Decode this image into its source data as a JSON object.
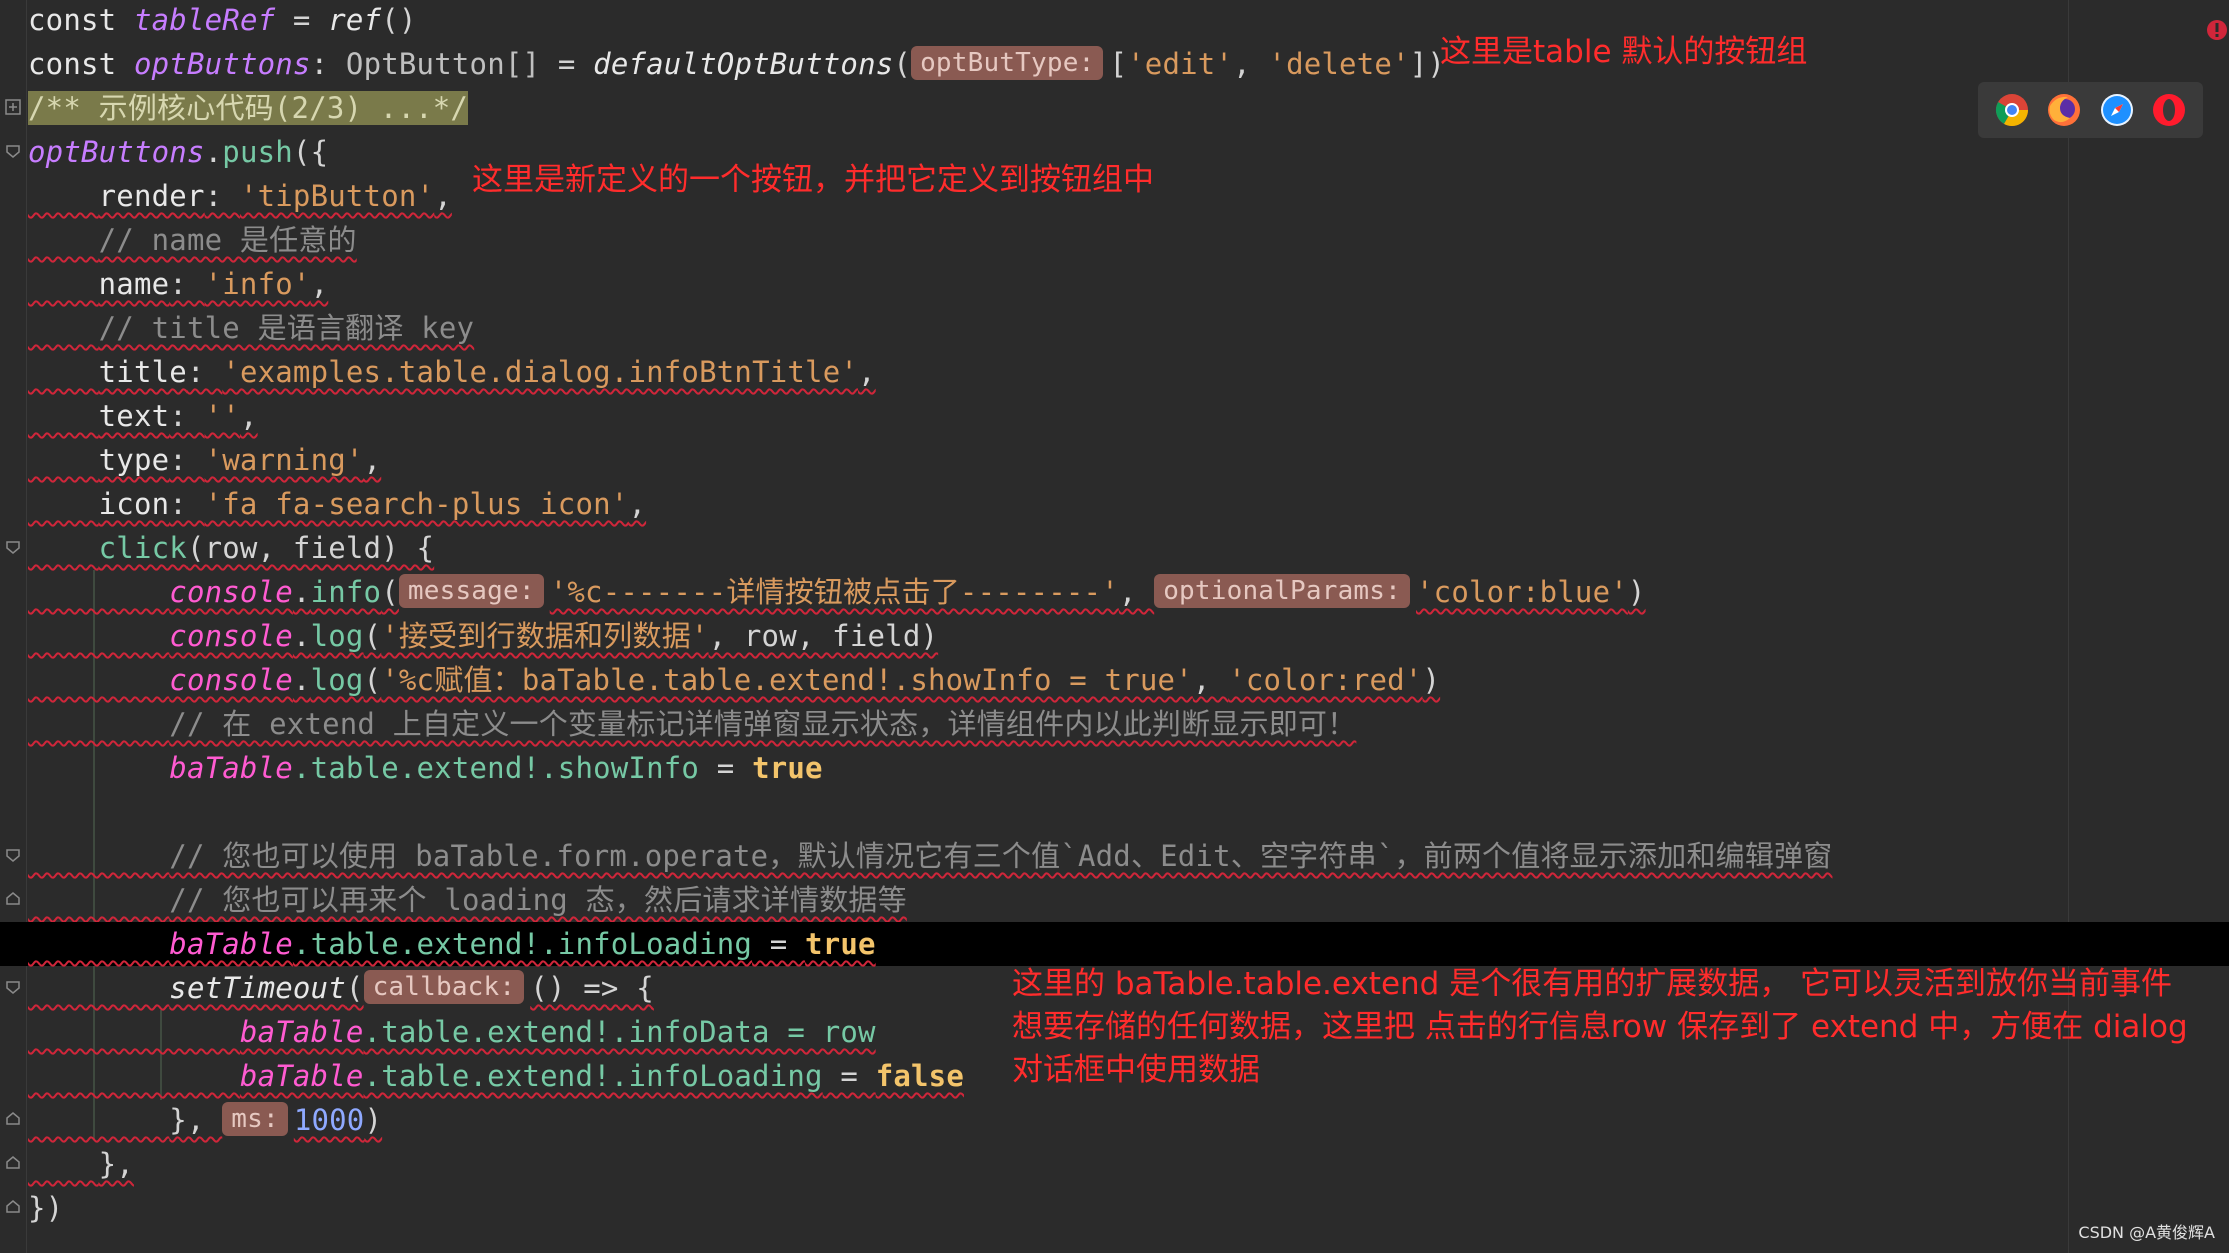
{
  "code": {
    "l1": {
      "kw": "const",
      "var": "tableRef",
      "op": " = ",
      "fn": "ref",
      "tail": "()"
    },
    "l2": {
      "kw": "const",
      "var": "optButtons",
      "colon": ": ",
      "type": "OptButton[]",
      "op": " = ",
      "fn": "defaultOptButtons",
      "open": "(",
      "hint": "optButType:",
      "arr_open": "[",
      "s1": "'edit'",
      "sep": ", ",
      "s2": "'delete'",
      "close": "])"
    },
    "l3": {
      "doc": "/** 示例核心代码(2/3) ...*/"
    },
    "l4": {
      "var": "optButtons",
      "dot": ".",
      "method": "push",
      "tail": "({"
    },
    "l5": {
      "indent": "    ",
      "prop": "render",
      "colon": ": ",
      "str": "'tipButton'",
      "tail": ","
    },
    "l6": {
      "indent": "    ",
      "cmt": "// name 是任意的"
    },
    "l7": {
      "indent": "    ",
      "prop": "name",
      "colon": ": ",
      "str": "'info'",
      "tail": ","
    },
    "l8": {
      "indent": "    ",
      "cmt": "// title 是语言翻译 key"
    },
    "l9": {
      "indent": "    ",
      "prop": "title",
      "colon": ": ",
      "str": "'examples.table.dialog.infoBtnTitle'",
      "tail": ","
    },
    "l10": {
      "indent": "    ",
      "prop": "text",
      "colon": ": ",
      "str": "''",
      "tail": ","
    },
    "l11": {
      "indent": "    ",
      "prop": "type",
      "colon": ": ",
      "str": "'warning'",
      "tail": ","
    },
    "l12": {
      "indent": "    ",
      "prop": "icon",
      "colon": ": ",
      "str": "'fa fa-search-plus icon'",
      "tail": ","
    },
    "l13": {
      "indent": "    ",
      "method": "click",
      "tail": "(row, field) {"
    },
    "l14": {
      "indent": "        ",
      "obj": "console",
      "dot": ".",
      "method": "info",
      "open": "(",
      "hint1": "message:",
      "str1": "'%c-------详情按钮被点击了--------'",
      "sep": ", ",
      "hint2": "optionalParams:",
      "str2": "'color:blue'",
      "close": ")"
    },
    "l15": {
      "indent": "        ",
      "obj": "console",
      "dot": ".",
      "method": "log",
      "open": "(",
      "str": "'接受到行数据和列数据'",
      "tail": ", row, field)"
    },
    "l16": {
      "indent": "        ",
      "obj": "console",
      "dot": ".",
      "method": "log",
      "open": "(",
      "str1": "'%c赋值：baTable.table.extend!.showInfo = true'",
      "sep": ", ",
      "str2": "'color:red'",
      "close": ")"
    },
    "l17": {
      "indent": "        ",
      "cmt": "// 在 extend 上自定义一个变量标记详情弹窗显示状态，详情组件内以此判断显示即可！"
    },
    "l18": {
      "indent": "        ",
      "obj": "baTable",
      "mid": ".table.extend!.showInfo",
      "op": " = ",
      "bool": "true"
    },
    "l20": {
      "indent": "        ",
      "cmt": "// 您也可以使用 baTable.form.operate，默认情况它有三个值`Add、Edit、空字符串`，前两个值将显示添加和编辑弹窗"
    },
    "l21": {
      "indent": "        ",
      "cmt": "// 您也可以再来个 loading 态，然后请求详情数据等"
    },
    "l22": {
      "indent": "        ",
      "obj": "baTable",
      "mid": ".table.extend!.infoLoading",
      "op": " = ",
      "bool": "true"
    },
    "l23": {
      "indent": "        ",
      "fn": "setTimeout",
      "open": "(",
      "hint": "callback:",
      "tail": "() => {"
    },
    "l24": {
      "indent": "            ",
      "obj": "baTable",
      "mid": ".table.extend!.infoData = row"
    },
    "l25": {
      "indent": "            ",
      "obj": "baTable",
      "mid": ".table.extend!.infoLoading",
      "op": " = ",
      "bool": "false"
    },
    "l26": {
      "indent": "        ",
      "head": "}, ",
      "hint": "ms:",
      "num": "1000",
      "tail": ")"
    },
    "l27": {
      "indent": "    ",
      "tail": "},"
    },
    "l28": {
      "tail": "})"
    }
  },
  "annotations": {
    "a1": "这里是table 默认的按钮组",
    "a2": "这里是新定义的一个按钮，并把它定义到按钮组中",
    "a3_1": "这里的 baTable.table.extend 是个很有用的扩展数据， 它可以灵活到放你当前事件",
    "a3_2": "想要存储的任何数据，这里把 点击的行信息row 保存到了 extend 中，方便在 dialog",
    "a3_3": "对话框中使用数据"
  },
  "browsers": [
    "chrome-icon",
    "firefox-icon",
    "safari-icon",
    "opera-icon"
  ],
  "watermark": "CSDN @A黄俊辉A",
  "colors": {
    "background": "#2b2b2b",
    "annotation": "#ff2c2c",
    "string": "#d99a5e",
    "variable": "#c77dff",
    "method": "#76c9a5",
    "boolean": "#f3c46b",
    "hint_bg": "#8a5a52",
    "comment": "#8c8c8c"
  }
}
